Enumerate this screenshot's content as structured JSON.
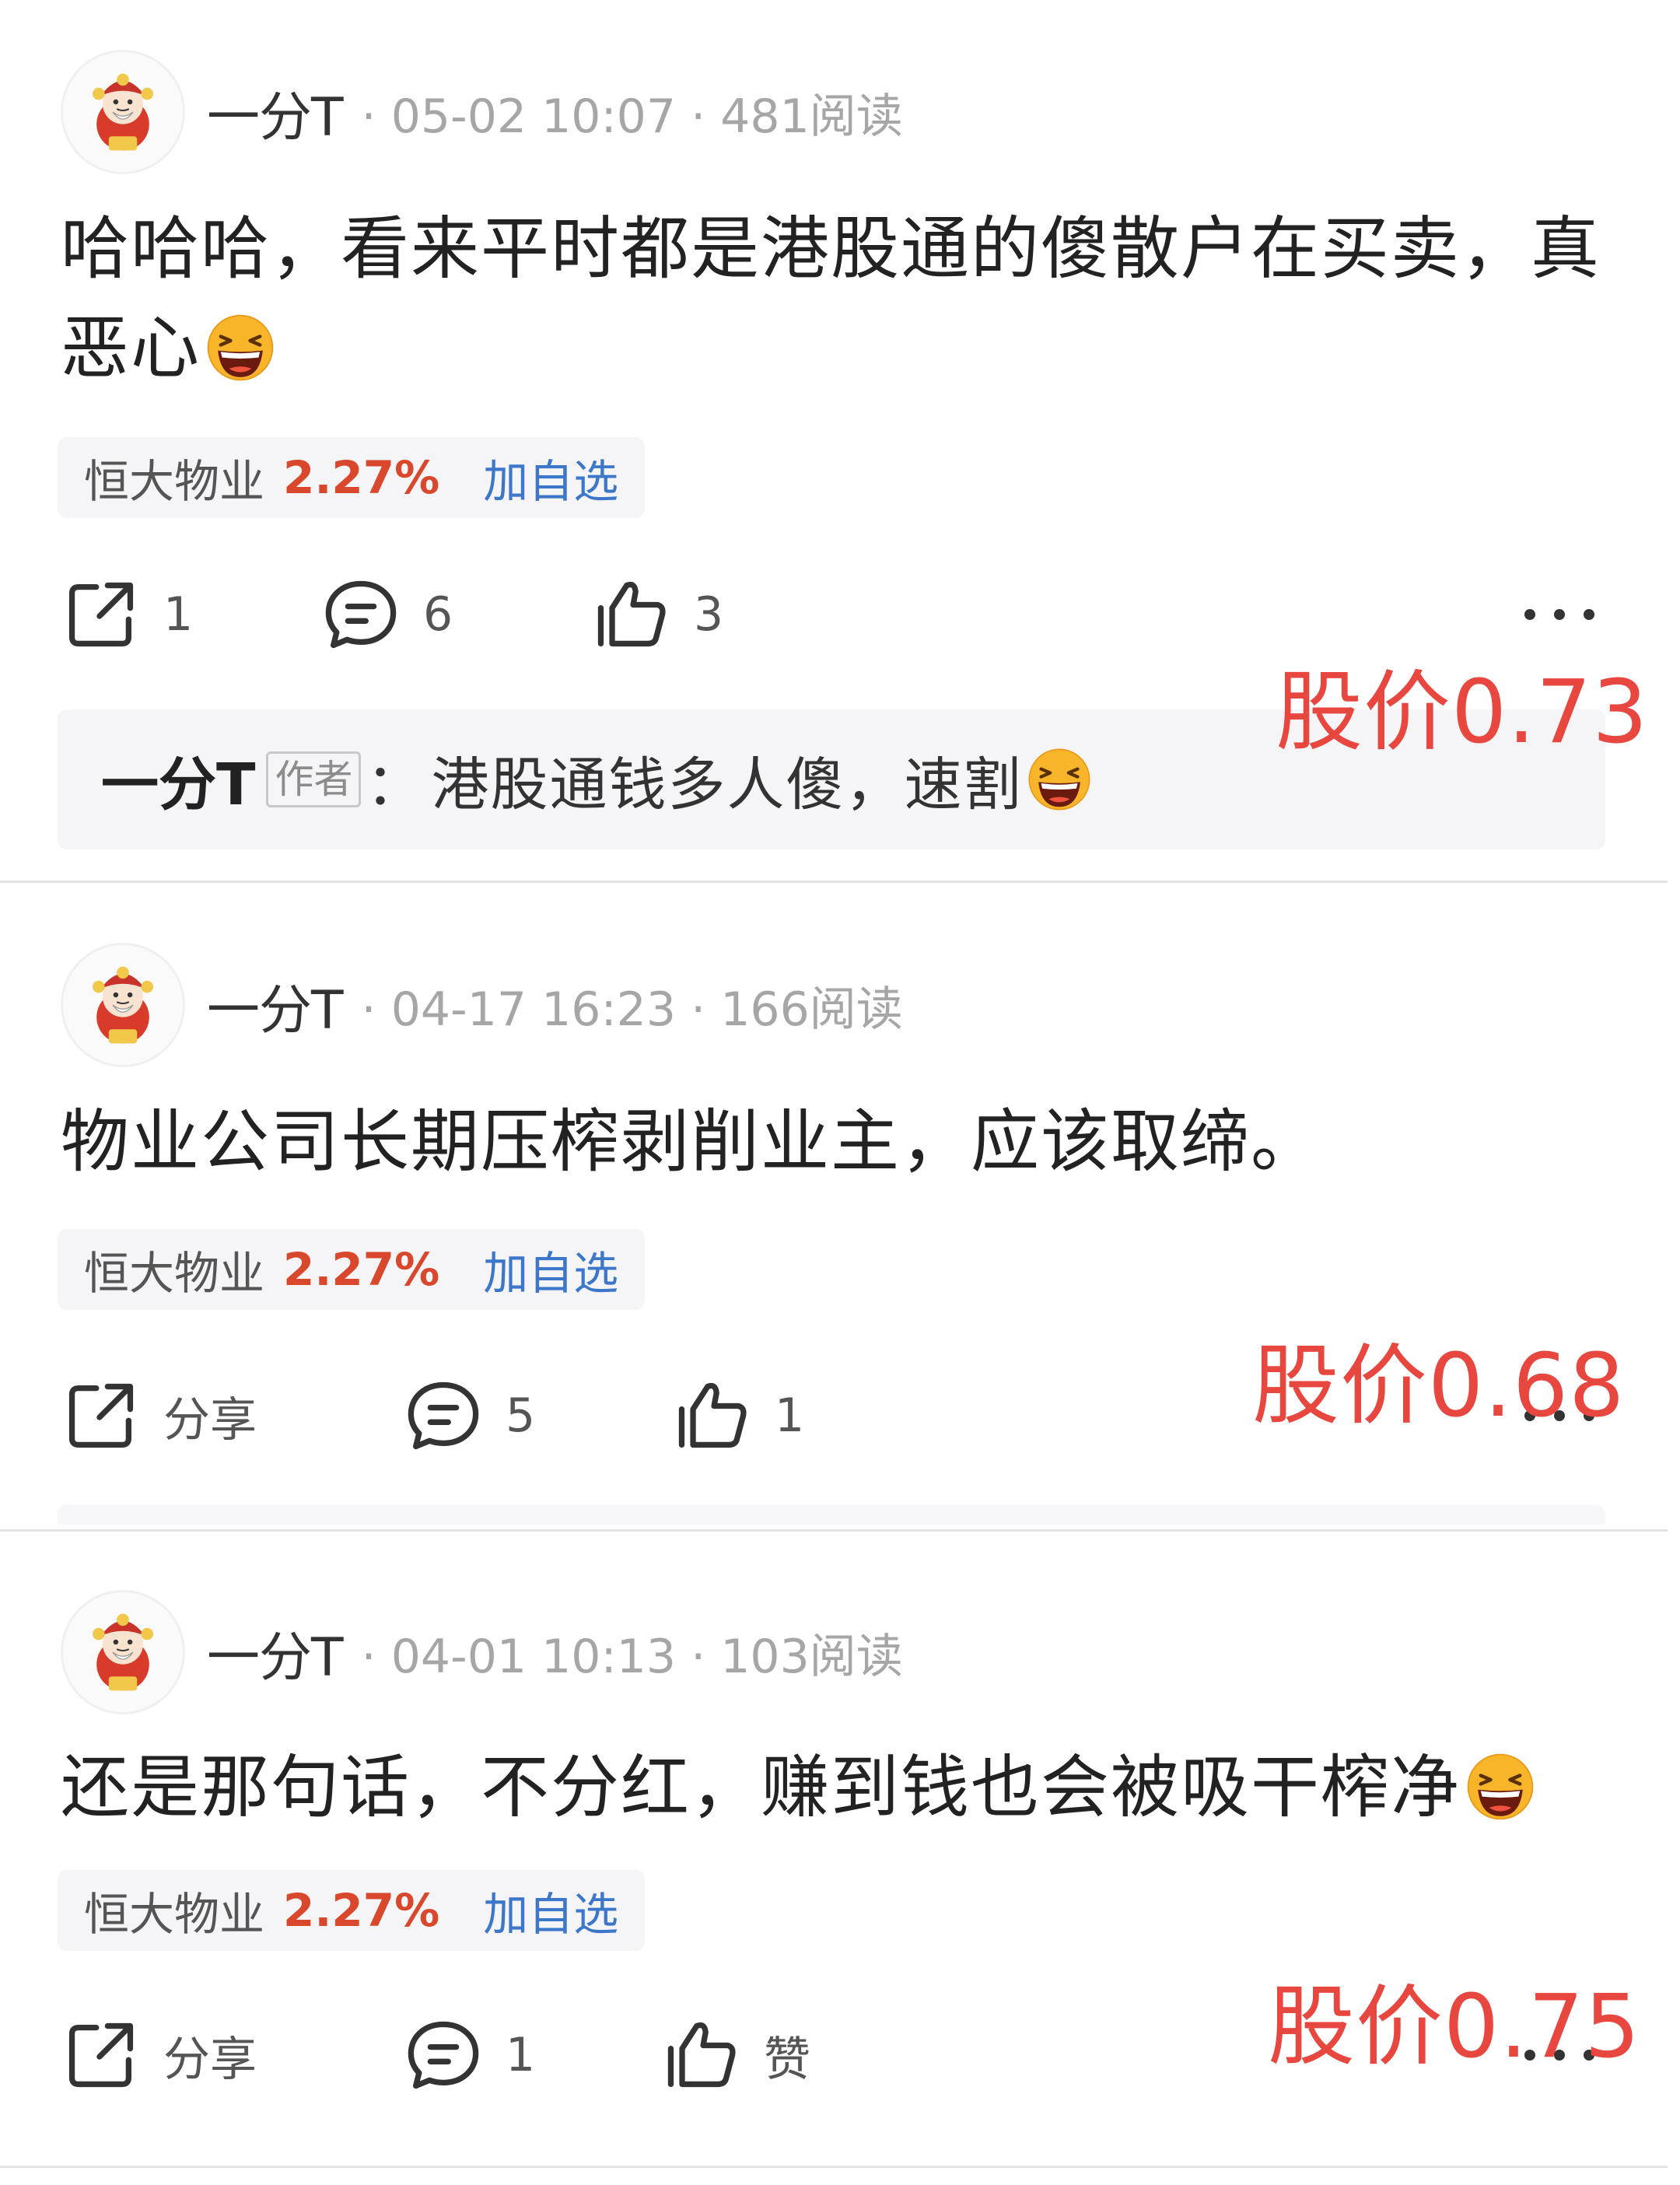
{
  "posts": [
    {
      "username": "一分T",
      "meta": "· 05-02 10:07 · 481阅读",
      "content": "哈哈哈，看来平时都是港股通的傻散户在买卖，真恶心",
      "emoji": "laughing-emoji",
      "stock": {
        "name": "恒大物业",
        "change": "2.27%",
        "add_label": "加自选"
      },
      "actions": {
        "share": "1",
        "comment": "6",
        "like": "3"
      },
      "reply": {
        "user": "一分T",
        "tag": "作者",
        "separator": "：",
        "text": "港股通钱多人傻，速割"
      },
      "price_note": "股价0.73"
    },
    {
      "username": "一分T",
      "meta": "· 04-17 16:23 · 166阅读",
      "content": "物业公司长期压榨剥削业主，应该取缔。",
      "stock": {
        "name": "恒大物业",
        "change": "2.27%",
        "add_label": "加自选"
      },
      "actions": {
        "share": "分享",
        "comment": "5",
        "like": "1"
      },
      "price_note": "股价0.68"
    },
    {
      "username": "一分T",
      "meta": "· 04-01 10:13 · 103阅读",
      "content": "还是那句话，不分红，赚到钱也会被吸干榨净",
      "emoji": "laughing-emoji",
      "stock": {
        "name": "恒大物业",
        "change": "2.27%",
        "add_label": "加自选"
      },
      "actions": {
        "share": "分享",
        "comment": "1",
        "like": "赞"
      },
      "price_note": "股价0.75"
    }
  ],
  "colors": {
    "price_note": "#e8473f",
    "stock_change": "#d9482c",
    "add_watch": "#3d77c9",
    "meta": "#a6a6a6",
    "tag_bg": "#f5f5f7"
  }
}
